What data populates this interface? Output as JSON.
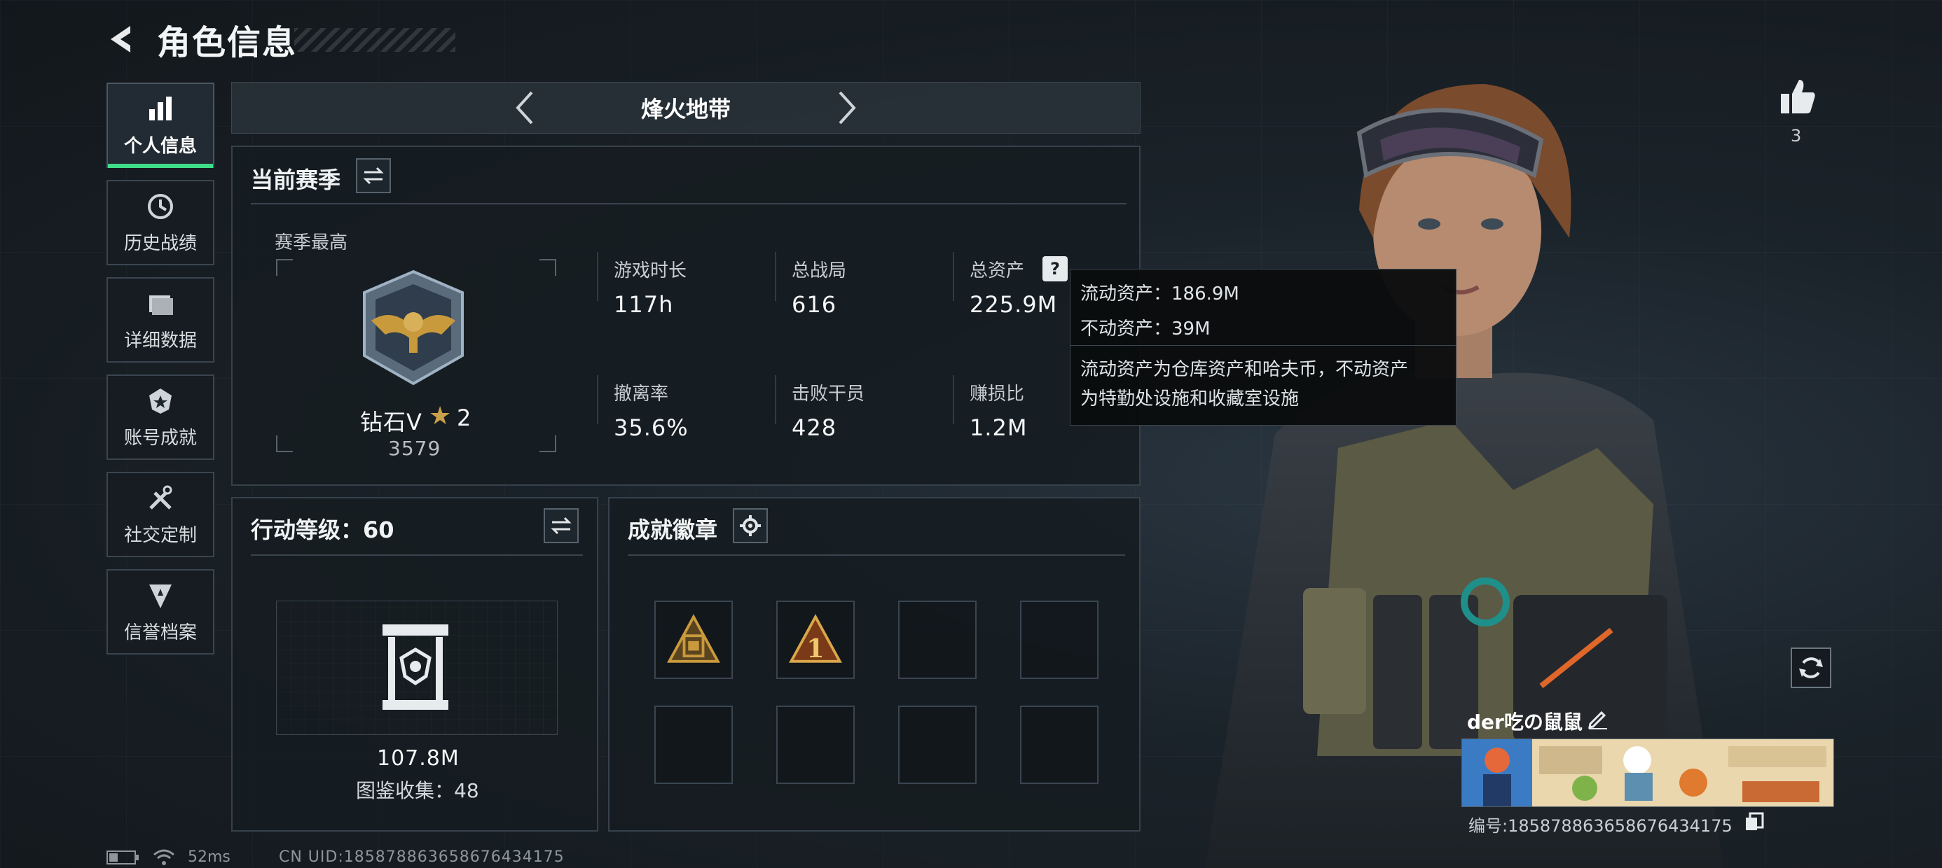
{
  "header": {
    "title": "角色信息"
  },
  "sidebar": {
    "items": [
      {
        "label": "个人信息",
        "icon": "bar-chart-icon",
        "active": true
      },
      {
        "label": "历史战绩",
        "icon": "history-icon"
      },
      {
        "label": "详细数据",
        "icon": "folder-icon"
      },
      {
        "label": "账号成就",
        "icon": "achievement-icon"
      },
      {
        "label": "社交定制",
        "icon": "tools-icon"
      },
      {
        "label": "信誉档案",
        "icon": "credit-icon"
      }
    ]
  },
  "mode": {
    "title": "烽火地带"
  },
  "season": {
    "title": "当前赛季",
    "best_label": "赛季最高",
    "rank_name": "钻石V",
    "rank_stars": "2",
    "rank_score": "3579",
    "stats": [
      {
        "label": "游戏时长",
        "value": "117h"
      },
      {
        "label": "总战局",
        "value": "616"
      },
      {
        "label": "总资产",
        "value": "225.9M"
      },
      {
        "label": "撤离率",
        "value": "35.6%"
      },
      {
        "label": "击败干员",
        "value": "428"
      },
      {
        "label": "赚损比",
        "value": "1.2M"
      }
    ],
    "help_symbol": "?"
  },
  "tooltip": {
    "liquid": "流动资产：186.9M",
    "fixed": "不动资产：39M",
    "desc_line1": "流动资产为仓库资产和哈夫币，不动资产",
    "desc_line2": "为特勤处设施和收藏室设施"
  },
  "action_level": {
    "title": "行动等级：60",
    "value": "107.8M",
    "collection": "图鉴收集：48"
  },
  "achievements": {
    "title": "成就徽章"
  },
  "player": {
    "likes": "3",
    "name": "der吃の鼠鼠",
    "id_text": "编号:185878863658676434175"
  },
  "status_bar": {
    "ping": "52ms",
    "uid": "CN UID:185878863658676434175"
  },
  "colors": {
    "accent_green": "#3fdc8a",
    "gold": "#c99a3c"
  }
}
